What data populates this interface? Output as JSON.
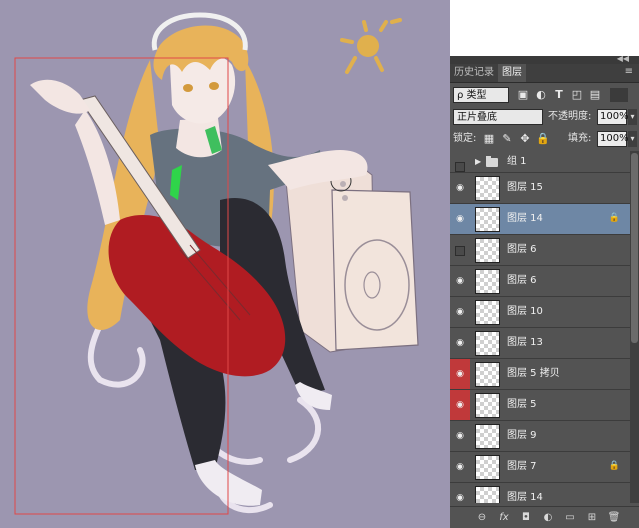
{
  "panel": {
    "collapse_glyph": "◀◀",
    "tabs": [
      {
        "label": "历史记录",
        "active": false
      },
      {
        "label": "图层",
        "active": true
      }
    ],
    "menu_icon": "≡",
    "filter": {
      "kind_label": "ρ 类型",
      "filter_icons": [
        "image-filter-icon",
        "adjustment-filter-icon",
        "text-filter-icon",
        "shape-filter-icon",
        "smart-object-filter-icon"
      ]
    },
    "blend": {
      "mode": "正片叠底",
      "opacity_label": "不透明度:",
      "opacity_value": "100%"
    },
    "lock": {
      "label": "锁定:",
      "fill_label": "填充:",
      "fill_value": "100%"
    },
    "layers": [
      {
        "name": "组 1",
        "type": "group",
        "visible": false,
        "red": false,
        "selected": false,
        "locked": false
      },
      {
        "name": "图层 15",
        "type": "layer",
        "visible": true,
        "red": false,
        "selected": false,
        "locked": false
      },
      {
        "name": "图层 14",
        "type": "layer",
        "visible": true,
        "red": false,
        "selected": true,
        "locked": true
      },
      {
        "name": "图层 6",
        "type": "layer",
        "visible": false,
        "red": false,
        "selected": false,
        "locked": false
      },
      {
        "name": "图层 6",
        "type": "layer",
        "visible": true,
        "red": false,
        "selected": false,
        "locked": false
      },
      {
        "name": "图层 10",
        "type": "layer",
        "visible": true,
        "red": false,
        "selected": false,
        "locked": false
      },
      {
        "name": "图层 13",
        "type": "layer",
        "visible": true,
        "red": false,
        "selected": false,
        "locked": false
      },
      {
        "name": "图层 5 拷贝",
        "type": "layer",
        "visible": true,
        "red": true,
        "selected": false,
        "locked": false
      },
      {
        "name": "图层 5",
        "type": "layer",
        "visible": true,
        "red": true,
        "selected": false,
        "locked": false
      },
      {
        "name": "图层 9",
        "type": "layer",
        "visible": true,
        "red": false,
        "selected": false,
        "locked": false
      },
      {
        "name": "图层 7",
        "type": "layer",
        "visible": true,
        "red": false,
        "selected": false,
        "locked": true
      },
      {
        "name": "图层 14",
        "type": "layer",
        "visible": true,
        "red": false,
        "selected": false,
        "locked": false
      }
    ],
    "bottom_icons": [
      "link-layers-icon",
      "fx-icon",
      "add-mask-icon",
      "adjustment-layer-icon",
      "new-group-icon",
      "new-layer-icon",
      "delete-layer-icon"
    ],
    "bottom_glyphs": [
      "⊖",
      "fx",
      "◘",
      "◐",
      "▭",
      "⊞",
      "🗑"
    ]
  },
  "colors": {
    "canvas_bg": "#9c96b0",
    "panel_bg": "#535353",
    "selected_layer": "#6e87a5",
    "eye_red": "#c0393a",
    "guide_red": "#e04848",
    "guitar_red": "#b01c22",
    "hair": "#e8b35a",
    "sun": "#e0b04d"
  }
}
